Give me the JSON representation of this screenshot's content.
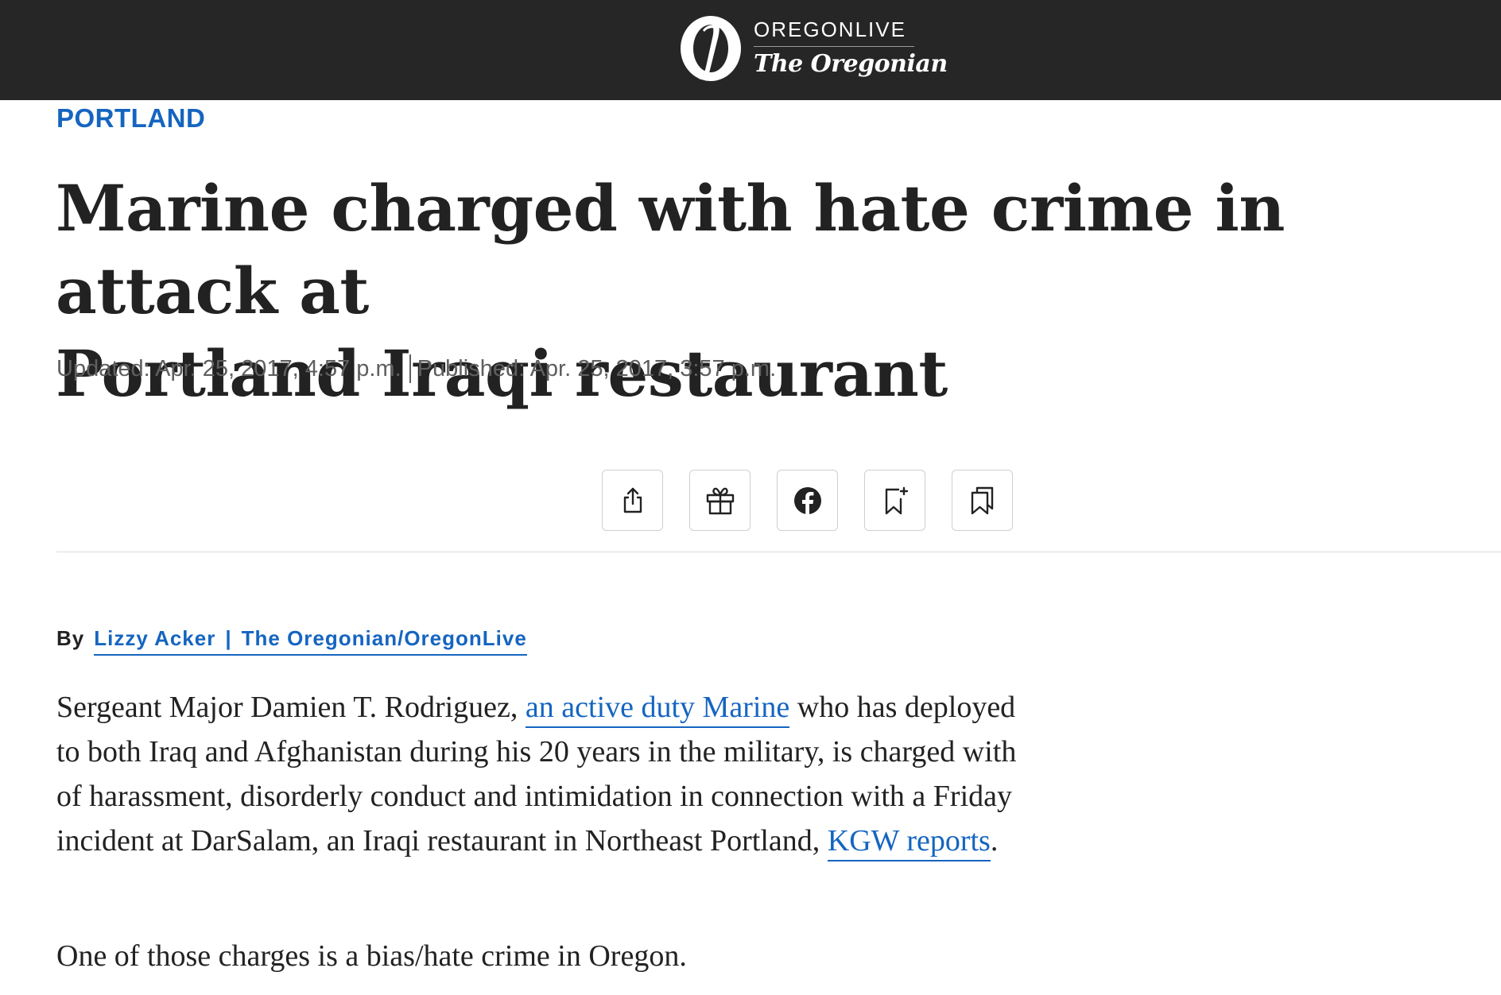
{
  "header": {
    "logo_line1": "OREGONLIVE",
    "logo_line2": "The Oregonian",
    "background_color": "#262626"
  },
  "article": {
    "section": "PORTLAND",
    "headline_line1": "Marine charged with hate crime in attack at",
    "headline_line2": "Portland Iraqi restaurant",
    "updated": "Updated: Apr. 25, 2017, 4:57 p.m.",
    "published": "Published: Apr. 25, 2017, 3:57 p.m.",
    "byline_prefix": "By",
    "author": "Lizzy Acker",
    "byline_separator": "|",
    "organization": "The Oregonian/OregonLive",
    "paragraph1": {
      "text_start": "Sergeant Major Damien T. Rodriguez, ",
      "link1": "an active duty Marine",
      "text_mid": " who has deployed to both Iraq and Afghanistan during his 20 years in the military, is charged with of harassment, disorderly conduct and intimidation in connection with a Friday incident at DarSalam, an Iraqi restaurant in Northeast Portland, ",
      "link2": "KGW reports",
      "text_end": "."
    },
    "paragraph2": "One of those charges is a bias/hate crime in Oregon."
  },
  "toolbar": {
    "buttons": [
      {
        "icon": "share-icon"
      },
      {
        "icon": "gift-icon"
      },
      {
        "icon": "facebook-icon"
      },
      {
        "icon": "bookmark-add-icon"
      },
      {
        "icon": "bookmarks-icon"
      }
    ]
  },
  "colors": {
    "accent": "#1565c0",
    "text": "#222222",
    "muted": "#5f5f5f"
  }
}
